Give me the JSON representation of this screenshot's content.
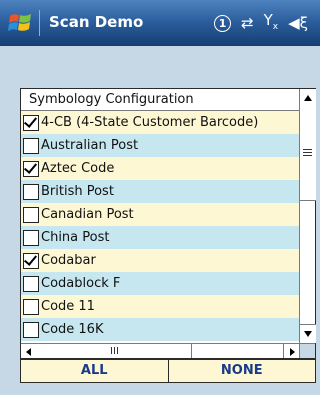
{
  "titlebar": {
    "title": "Scan Demo",
    "icons": [
      "windows-logo-icon",
      "sim-1-icon",
      "data-connection-icon",
      "no-signal-icon",
      "volume-icon"
    ],
    "sim_indicator": "1"
  },
  "list": {
    "header": "Symbology Configuration",
    "items": [
      {
        "label": "4-CB (4-State Customer Barcode)",
        "checked": true
      },
      {
        "label": "Australian Post",
        "checked": false
      },
      {
        "label": "Aztec Code",
        "checked": true
      },
      {
        "label": "British Post",
        "checked": false
      },
      {
        "label": "Canadian Post",
        "checked": false
      },
      {
        "label": "China Post",
        "checked": false
      },
      {
        "label": "Codabar",
        "checked": true
      },
      {
        "label": "Codablock F",
        "checked": false
      },
      {
        "label": "Code 11",
        "checked": false
      },
      {
        "label": "Code 16K",
        "checked": false
      }
    ]
  },
  "buttons": {
    "all_label": "ALL",
    "none_label": "NONE"
  },
  "colors": {
    "row_odd": "#fdf7d4",
    "row_even": "#c6e7f0",
    "background": "#c6d7e6",
    "button_text": "#1a3a8a"
  }
}
